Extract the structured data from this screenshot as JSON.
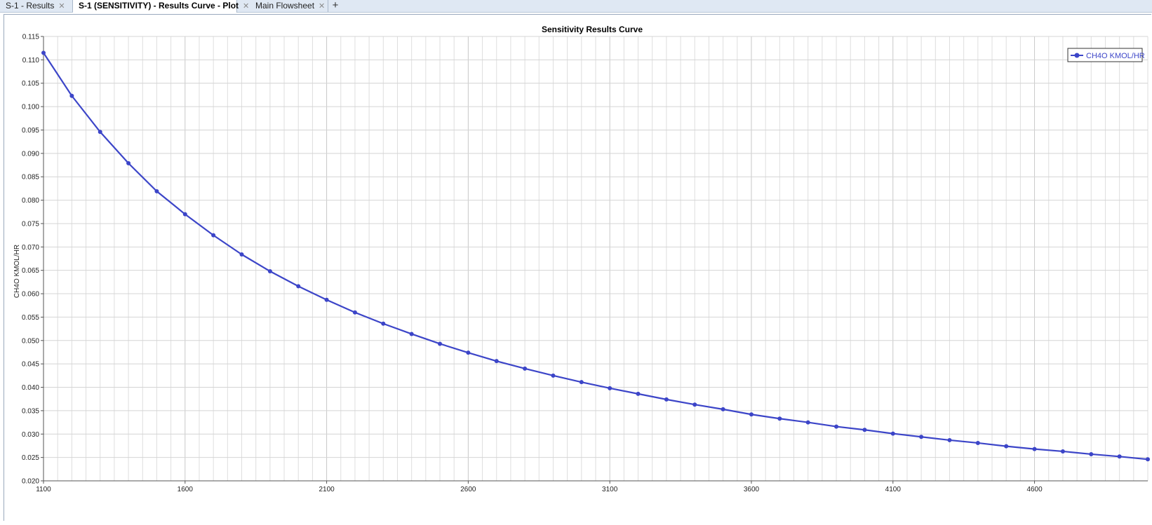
{
  "tabs": [
    {
      "label": "S-1 - Results",
      "active": false
    },
    {
      "label": "S-1 (SENSITIVITY) - Results Curve - Plot",
      "active": true
    },
    {
      "label": "Main Flowsheet",
      "active": false
    }
  ],
  "add_tab_label": "+",
  "chart_data": {
    "type": "line",
    "title": "Sensitivity Results Curve",
    "xlabel": "",
    "ylabel": "CH4O KMOL/HR",
    "xlim": [
      1100,
      5000
    ],
    "ylim": [
      0.02,
      0.115
    ],
    "x_ticks": [
      1100,
      1600,
      2100,
      2600,
      3100,
      3600,
      4100,
      4600
    ],
    "y_ticks": [
      "0.020",
      "0.025",
      "0.030",
      "0.035",
      "0.040",
      "0.045",
      "0.050",
      "0.055",
      "0.060",
      "0.065",
      "0.070",
      "0.075",
      "0.080",
      "0.085",
      "0.090",
      "0.095",
      "0.100",
      "0.105",
      "0.110",
      "0.115"
    ],
    "grid": true,
    "legend_position": "top-right",
    "series": [
      {
        "name": "CH4O KMOL/HR",
        "color": "#3c45c8",
        "x": [
          1100,
          1200,
          1300,
          1400,
          1500,
          1600,
          1700,
          1800,
          1900,
          2000,
          2100,
          2200,
          2300,
          2400,
          2500,
          2600,
          2700,
          2800,
          2900,
          3000,
          3100,
          3200,
          3300,
          3400,
          3500,
          3600,
          3700,
          3800,
          3900,
          4000,
          4100,
          4200,
          4300,
          4400,
          4500,
          4600,
          4700,
          4800,
          4900,
          5000
        ],
        "y": [
          0.1115,
          0.1023,
          0.0946,
          0.0879,
          0.0819,
          0.077,
          0.0725,
          0.0684,
          0.0648,
          0.0616,
          0.0587,
          0.056,
          0.0536,
          0.0514,
          0.0493,
          0.0474,
          0.0456,
          0.044,
          0.0425,
          0.0411,
          0.0398,
          0.0386,
          0.0374,
          0.0363,
          0.0353,
          0.0342,
          0.0333,
          0.0325,
          0.0316,
          0.0309,
          0.0301,
          0.0294,
          0.0287,
          0.0281,
          0.0274,
          0.0268,
          0.0263,
          0.0257,
          0.0252,
          0.0246
        ]
      }
    ]
  }
}
